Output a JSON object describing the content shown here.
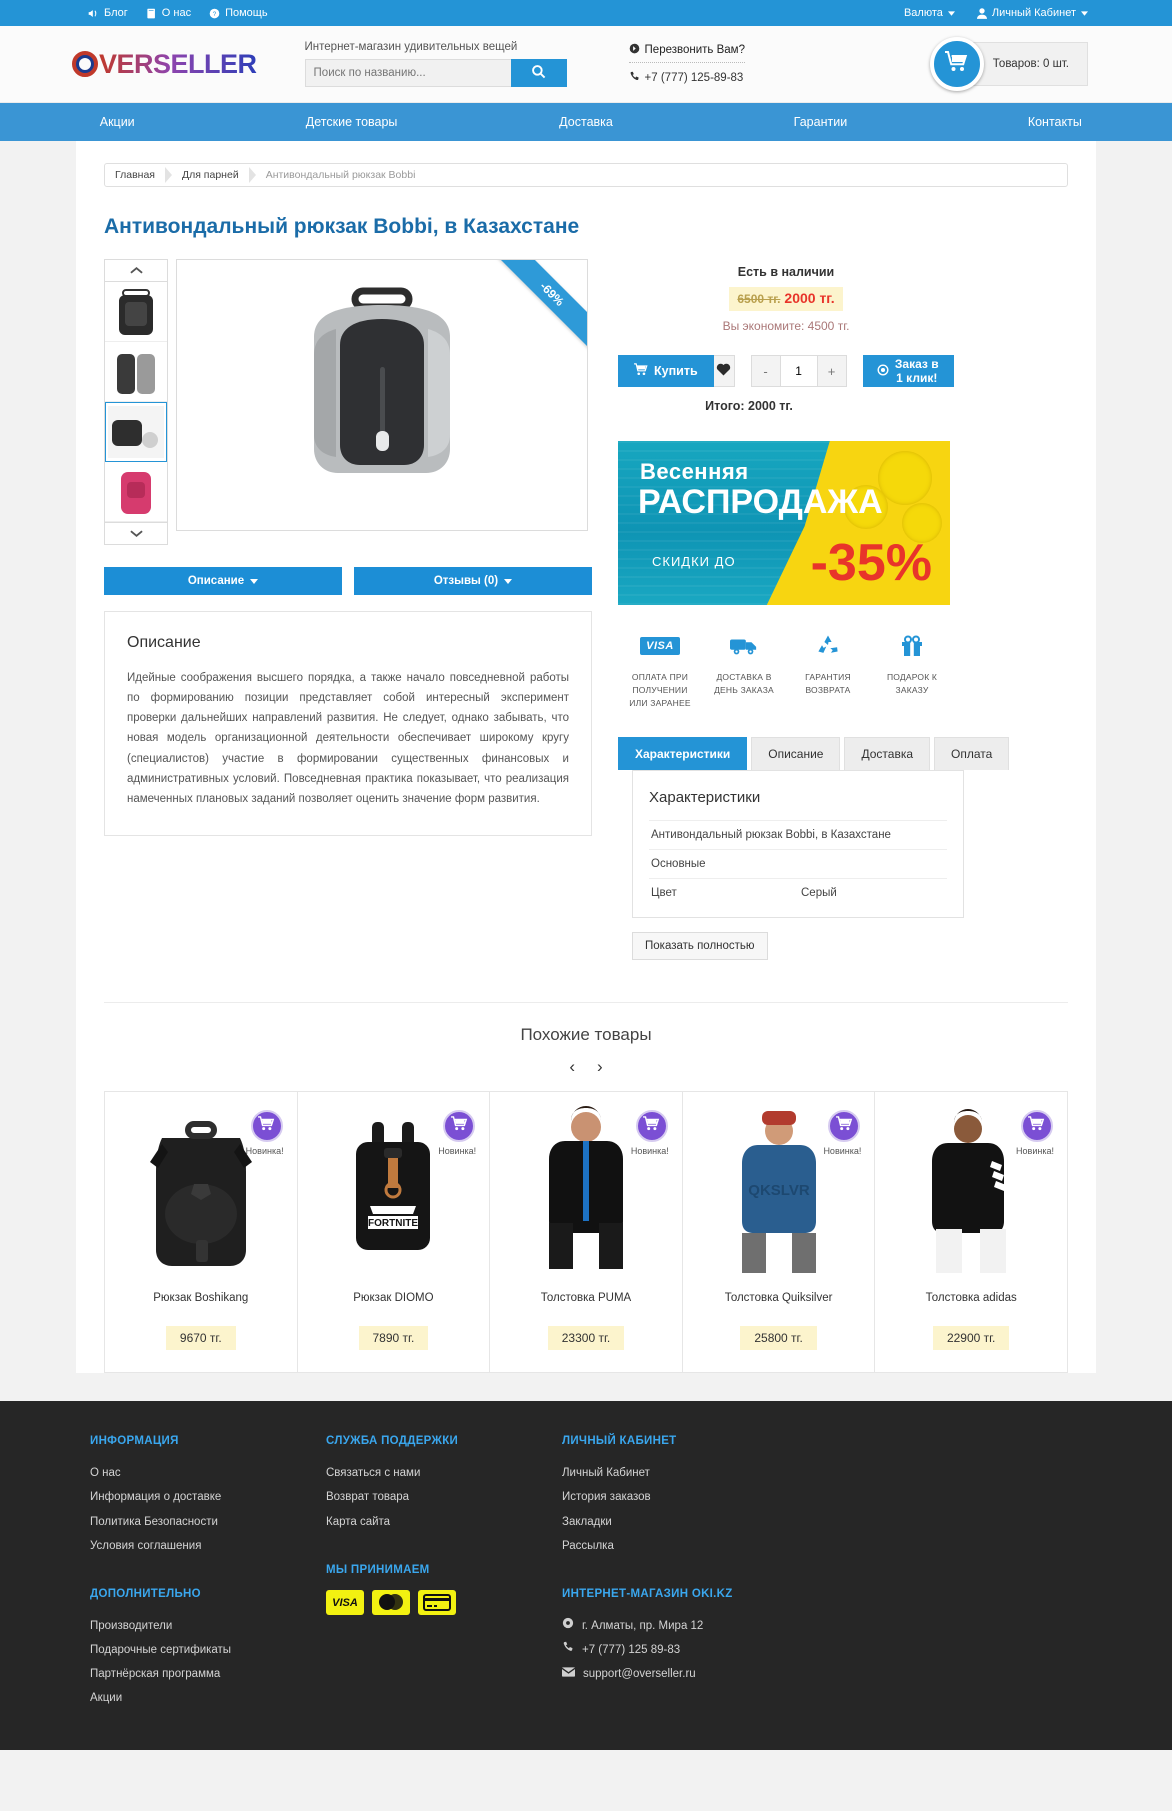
{
  "topbar": {
    "left": [
      {
        "label": "Блог",
        "icon": "megaphone-icon"
      },
      {
        "label": "О нас",
        "icon": "book-icon"
      },
      {
        "label": "Помощь",
        "icon": "help-icon"
      }
    ],
    "currency": "Валюта",
    "account": "Личный Кабинет"
  },
  "header": {
    "logo_first": "O",
    "logo_rest": "VERSELLER",
    "slogan": "Интернет-магазин удивительных вещей",
    "search_placeholder": "Поиск по названию...",
    "search_value": "",
    "callback": "Перезвонить Вам?",
    "phone": "+7 (777) 125-89-83",
    "cart_label": "Товаров: 0 шт."
  },
  "nav": [
    "Акции",
    "Детские товары",
    "Доставка",
    "Гарантии",
    "Контакты"
  ],
  "breadcrumb": [
    "Главная",
    "Для парней",
    "Антивондальный рюкзак Bobbi"
  ],
  "product": {
    "title": "Антивондальный рюкзак Bobbi, в Казахстане",
    "discount_badge": "-69%",
    "stock": "Есть в наличии",
    "old_price": "6500 тг.",
    "new_price": "2000 тг.",
    "save": "Вы экономите: 4500 тг.",
    "buy_label": "Купить",
    "qty": "1",
    "qty_minus": "-",
    "qty_plus": "+",
    "oneclick_label": "Заказ в 1 клик!",
    "total": "Итого: 2000 тг."
  },
  "desc_buttons": [
    "Описание",
    "Отзывы (0)"
  ],
  "description": {
    "heading": "Описание",
    "body": "Идейные соображения высшего порядка, а также начало повседневной работы по формированию позиции представляет собой интересный эксперимент проверки дальнейших направлений развития. Не следует, однако забывать, что новая модель организационной деятельности обеспечивает широкому кругу (специалистов) участие в формировании существенных финансовых и административных условий. Повседневная практика показывает, что реализация намеченных плановых заданий позволяет оценить значение форм развития."
  },
  "banner": {
    "line1": "Весенняя",
    "line2": "РАСПРОДАЖА",
    "line3": "СКИДКИ ДО",
    "line4": "-35%"
  },
  "features": [
    {
      "icon": "visa-icon",
      "caption": "ОПЛАТА ПРИ ПОЛУЧЕНИИ ИЛИ ЗАРАНЕЕ"
    },
    {
      "icon": "truck-icon",
      "caption": "ДОСТАВКА В ДЕНЬ ЗАКАЗА"
    },
    {
      "icon": "recycle-icon",
      "caption": "ГАРАНТИЯ ВОЗВРАТА"
    },
    {
      "icon": "gift-icon",
      "caption": "ПОДАРОК К ЗАКАЗУ"
    }
  ],
  "tabs": [
    "Характеристики",
    "Описание",
    "Доставка",
    "Оплата"
  ],
  "specs": {
    "heading": "Характеристики",
    "rows": [
      {
        "key": "Антивондальный рюкзак Bobbi, в Казахстане",
        "value": ""
      },
      {
        "key": "Основные",
        "value": ""
      },
      {
        "key": "Цвет",
        "value": "Серый"
      }
    ],
    "show_all": "Показать полностью"
  },
  "similar": {
    "title": "Похожие товары",
    "prev": "‹",
    "next": "›",
    "badge": "Новинка!",
    "items": [
      {
        "name": "Рюкзак Boshikang",
        "price": "9670 тг.",
        "kind": "backpack-black"
      },
      {
        "name": "Рюкзак DIOMO",
        "price": "7890 тг.",
        "kind": "backpack-fortnite"
      },
      {
        "name": "Толстовка PUMA",
        "price": "23300 тг.",
        "kind": "hoodie-puma"
      },
      {
        "name": "Толстовка Quiksilver",
        "price": "25800 тг.",
        "kind": "hoodie-quiksilver"
      },
      {
        "name": "Толстовка adidas",
        "price": "22900 тг.",
        "kind": "hoodie-adidas"
      }
    ]
  },
  "footer": {
    "col1_head": "ИНФОРМАЦИЯ",
    "col1_links": [
      "О нас",
      "Информация о доставке",
      "Политика Безопасности",
      "Условия соглашения"
    ],
    "col1b_head": "ДОПОЛНИТЕЛЬНО",
    "col1b_links": [
      "Производители",
      "Подарочные сертификаты",
      "Партнёрская программа",
      "Акции"
    ],
    "col2_head": "СЛУЖБА ПОДДЕРЖКИ",
    "col2_links": [
      "Связаться с нами",
      "Возврат товара",
      "Карта сайта"
    ],
    "col2b_head": "МЫ ПРИНИМАЕМ",
    "col3_head": "ЛИЧНЫЙ КАБИНЕТ",
    "col3_links": [
      "Личный Кабинет",
      "История заказов",
      "Закладки",
      "Рассылка"
    ],
    "col3b_head": "ИНТЕРНЕТ-МАГАЗИН OKI.KZ",
    "address": "г. Алматы, пр. Мира 12",
    "phone": "+7 (777) 125 89-83",
    "email": "support@overseller.ru"
  },
  "colors": {
    "accent": "#2494d6",
    "nav": "#3a95d4",
    "price_red": "#e8342a",
    "highlight": "#fcf4cd",
    "footer_bg": "#262626",
    "footer_head": "#3aa7ee"
  }
}
